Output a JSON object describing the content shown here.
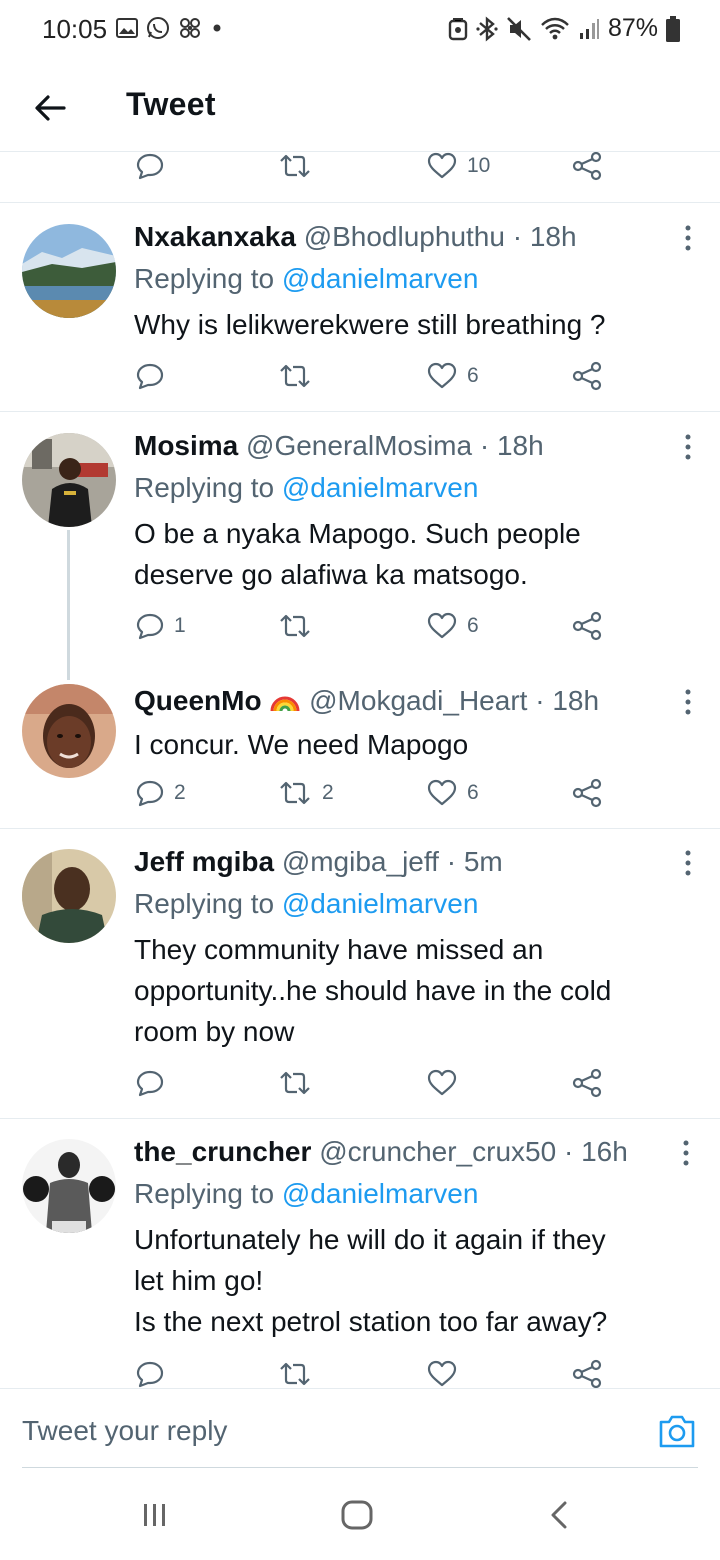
{
  "status_bar": {
    "time": "10:05",
    "battery": "87%",
    "left_icons": [
      "gallery-icon",
      "whatsapp-icon",
      "fan-icon",
      "dot-icon"
    ],
    "right_icons": [
      "nfc-icon",
      "bluetooth-icon",
      "mute-icon",
      "wifi-icon",
      "signal-icon",
      "battery-icon"
    ]
  },
  "header": {
    "title": "Tweet",
    "back_icon": "arrow-left-icon"
  },
  "top_actions": {
    "like_count": "10"
  },
  "tweets": [
    {
      "name": "Nxakanxaka",
      "handle": "@Bhodluphuthu",
      "time": "18h",
      "replying_label": "Replying to",
      "replying_to": "@danielmarven",
      "text": "Why is lelikwerekwere still breathing ?",
      "reply_count": "",
      "retweet_count": "",
      "like_count": "6"
    },
    {
      "name": "Mosima",
      "handle": "@GeneralMosima",
      "time": "18h",
      "replying_label": "Replying to",
      "replying_to": "@danielmarven",
      "text": "O be a nyaka Mapogo. Such people\ndeserve go alafiwa ka matsogo.",
      "reply_count": "1",
      "retweet_count": "",
      "like_count": "6"
    },
    {
      "name": "QueenMo",
      "name_emoji": "rainbow-icon",
      "handle": "@Mokgadi_Heart",
      "time": "18h",
      "text": "I concur. We need Mapogo",
      "reply_count": "2",
      "retweet_count": "2",
      "like_count": "6"
    },
    {
      "name": "Jeff mgiba",
      "handle": "@mgiba_jeff",
      "time": "5m",
      "replying_label": "Replying to",
      "replying_to": "@danielmarven",
      "text": "They community have missed an\nopportunity..he should have in the  cold\nroom by now",
      "reply_count": "",
      "retweet_count": "",
      "like_count": ""
    },
    {
      "name": "the_cruncher",
      "handle": "@cruncher_crux50",
      "time": "16h",
      "replying_label": "Replying to",
      "replying_to": "@danielmarven",
      "text": "Unfortunately he will do it again if they\nlet him go!\nIs the next petrol station too far away?",
      "reply_count": "",
      "retweet_count": "",
      "like_count": ""
    }
  ],
  "composer": {
    "placeholder": "Tweet your reply",
    "camera_icon": "camera-icon"
  },
  "navbar": {
    "icons": [
      "recents-icon",
      "home-icon",
      "back-icon"
    ]
  },
  "colors": {
    "accent": "#1d9bf0",
    "text_primary": "#0f1419",
    "text_secondary": "#536471",
    "divider": "#e6ecf0"
  }
}
